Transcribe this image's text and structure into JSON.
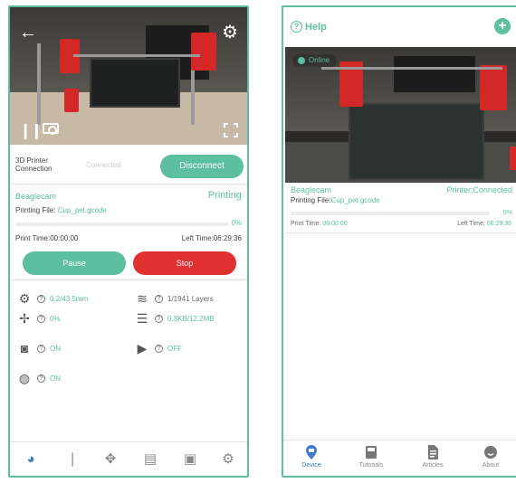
{
  "colors": {
    "accent": "#5bbfa0",
    "stop": "#e03030",
    "active_nav": "#3b7bd0"
  },
  "left": {
    "camera": {
      "icons": [
        "back-arrow-icon",
        "gear-icon",
        "pause-icon",
        "camera-icon",
        "fullscreen-icon"
      ]
    },
    "connection": {
      "label": "3D Printer Connection",
      "status": "Connected",
      "button": "Disconnect"
    },
    "job": {
      "camera_name": "Beaglecam",
      "state": "Printing",
      "file_label": "Printing File:",
      "file_name": "Cup_pet.gcode",
      "progress_pct": 0,
      "progress_text": "0%",
      "print_time": "Print Time:00:00:00",
      "left_time": "Left Time:06:29:36",
      "pause_label": "Pause",
      "stop_label": "Stop"
    },
    "stats": {
      "nozzle": "0.2/43.5mm",
      "layers": "1/1941 Layers",
      "fan": "0%",
      "storage": "0.3KB/12.2MB",
      "timelapse_label": "ON",
      "recording_label": "OFF",
      "ai_label": "ON"
    },
    "nav_icons": [
      "dashboard-icon",
      "thermometer-icon",
      "move-icon",
      "files-icon",
      "gcode-icon",
      "settings-icon"
    ]
  },
  "right": {
    "header": {
      "help_label": "Help",
      "add_icon": "plus-icon"
    },
    "card": {
      "badge": "Online",
      "name": "Beaglecam",
      "status": "Printer:Connected",
      "file_label": "Printing File:",
      "file_name": "Cup_pet.gcode",
      "progress_pct": 0,
      "progress_text": "0%",
      "print_time_label": "Print Time:",
      "print_time": "00:00:00",
      "left_time_label": "Left Time:",
      "left_time": "06:29:36"
    },
    "nav": [
      {
        "label": "Device",
        "icon": "device-icon"
      },
      {
        "label": "Tutorials",
        "icon": "book-icon"
      },
      {
        "label": "Articles",
        "icon": "document-icon"
      },
      {
        "label": "About",
        "icon": "smiley-icon"
      }
    ]
  }
}
